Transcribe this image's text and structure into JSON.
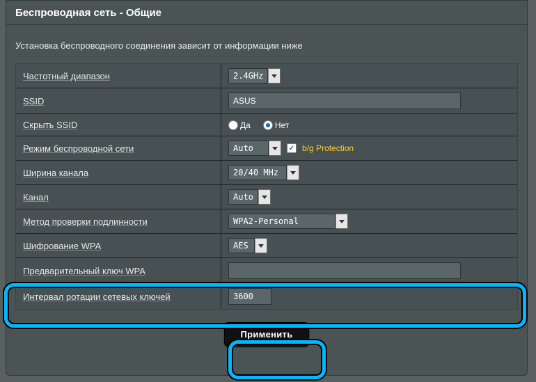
{
  "title": "Беспроводная сеть - Общие",
  "subtitle": "Установка беспроводного соединения зависит от информации ниже",
  "rows": {
    "band": {
      "label": "Частотный диапазон",
      "value": "2.4GHz"
    },
    "ssid": {
      "label": "SSID",
      "value": "ASUS"
    },
    "hide_ssid": {
      "label": "Скрыть SSID",
      "yes": "Да",
      "no": "Нет",
      "selected": "no"
    },
    "mode": {
      "label": "Режим беспроводной сети",
      "value": "Auto",
      "bgprotect_label": "b/g Protection",
      "bgprotect_checked": true
    },
    "width": {
      "label": "Ширина канала",
      "value": "20/40 MHz"
    },
    "channel": {
      "label": "Канал",
      "value": "Auto"
    },
    "auth": {
      "label": "Метод проверки подлинности",
      "value": "WPA2-Personal"
    },
    "wpa_enc": {
      "label": "Шифрование WPA",
      "value": "AES"
    },
    "psk": {
      "label": "Предварительный ключ WPA",
      "value": ""
    },
    "rekey": {
      "label": "Интервал ротации сетевых ключей",
      "value": "3600"
    }
  },
  "apply_label": "Применить"
}
